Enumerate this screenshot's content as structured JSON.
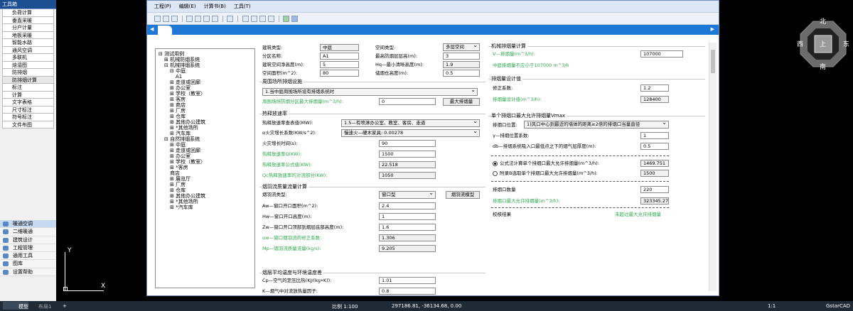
{
  "toolbox": {
    "title": "工具箱",
    "commands": [
      "负荷计算",
      "垂直采暖",
      "分户计量",
      "地板采暖",
      "智能水路",
      "通风空调",
      "多联机",
      "焓湿图",
      "防排烟",
      "防排烟计算",
      "标注",
      "计算",
      "文字表格",
      "尺寸标注",
      "符号标注",
      "文件布图"
    ],
    "active_index": 9,
    "categories": [
      "暖通空调",
      "二维暖通",
      "建筑设计",
      "工程管理",
      "通用工具",
      "图库",
      "设置帮助"
    ],
    "active_category": 0
  },
  "window": {
    "menus": [
      "工程(P)",
      "编辑(E)",
      "计算书(B)",
      "工具(T)"
    ]
  },
  "tree": {
    "root": "测试用例",
    "nodes": [
      {
        "t": "机械防烟系统",
        "lv": 1,
        "e": "+"
      },
      {
        "t": "机械排烟系统",
        "lv": 1,
        "e": "-"
      },
      {
        "t": "中庭",
        "lv": 2,
        "e": "-"
      },
      {
        "t": "A1",
        "lv": 3,
        "e": ""
      },
      {
        "t": "走道或回廊",
        "lv": 2,
        "e": "+"
      },
      {
        "t": "办公室",
        "lv": 2,
        "e": "+"
      },
      {
        "t": "学校（教室）",
        "lv": 2,
        "e": "+"
      },
      {
        "t": "客房",
        "lv": 2,
        "e": "+"
      },
      {
        "t": "商店",
        "lv": 2,
        "e": "+"
      },
      {
        "t": "厂房",
        "lv": 2,
        "e": "+"
      },
      {
        "t": "仓库",
        "lv": 2,
        "e": "+"
      },
      {
        "t": "其他办公建筑",
        "lv": 2,
        "e": "+"
      },
      {
        "t": "*其他场所",
        "lv": 2,
        "e": "+"
      },
      {
        "t": "汽车库",
        "lv": 2,
        "e": "+"
      },
      {
        "t": "自然排烟系统",
        "lv": 1,
        "e": "-"
      },
      {
        "t": "中庭",
        "lv": 2,
        "e": "+"
      },
      {
        "t": "走道或回廊",
        "lv": 2,
        "e": "+"
      },
      {
        "t": "办公室",
        "lv": 2,
        "e": "+"
      },
      {
        "t": "学校（教室）",
        "lv": 2,
        "e": "+"
      },
      {
        "t": "*客房",
        "lv": 2,
        "e": "+"
      },
      {
        "t": "商店",
        "lv": 2,
        "e": ""
      },
      {
        "t": "展览厅",
        "lv": 2,
        "e": "+"
      },
      {
        "t": "厂房",
        "lv": 2,
        "e": "+"
      },
      {
        "t": "仓库",
        "lv": 2,
        "e": "+"
      },
      {
        "t": "其他办公建筑",
        "lv": 2,
        "e": "+"
      },
      {
        "t": "*其他场所",
        "lv": 2,
        "e": "+"
      },
      {
        "t": "*汽车库",
        "lv": 2,
        "e": "+"
      }
    ]
  },
  "form": {
    "building_type_label": "建筑类型:",
    "building_type": "中庭",
    "space_type_label": "空间类型:",
    "space_type": "多层空间",
    "zone_name_label": "分区名称:",
    "zone_name": "A1",
    "max_floor_h_label": "最高防烟层层高(m):",
    "max_floor_h": "3",
    "net_h_label": "建筑空间净高度(m):",
    "net_h": "5",
    "hq_label": "Hq—最小清晰高度(m):",
    "hq": "1.9",
    "area_label": "空间面积(m^2):",
    "area": "80",
    "storage_h_label": "储烟仓高度(m):",
    "storage_h": "0.5",
    "surround_header": "周围场所排烟设施",
    "surround_select": "1.当中庭周围场所设有排烟系统时",
    "surround_flow_label": "周围场所防烟分区最大排烟量(m^3/h):",
    "surround_flow": "0",
    "max_exhaust_btn": "最大排烟量",
    "heat_header": "热释放速率",
    "heat_table_label": "热释放速率查表值(MW):",
    "heat_table_value": "1.5—有喷淋办公室、教室、客房、走道",
    "alpha_label": "α火灾增长系数(KW/s^2):",
    "alpha_value": "慢速火—硬木家具: 0.00278",
    "fire_time_label": "火灾增长时间(s):",
    "fire_time": "90",
    "heat_rate_label": "热释放速率Q(KW):",
    "heat_rate": "1500",
    "heat_formula_label": "热释放速率公式值(KW):",
    "heat_formula": "22.518",
    "qc_label": "Qc热释放速率的对流部分(KW):",
    "qc": "1050",
    "plume_header": "烟羽流质量流量计算",
    "plume_type_label": "烟羽流类型:",
    "plume_type": "窗口型",
    "plume_model_btn": "烟羽流模型",
    "aw_label": "Aw—窗口开口面积(m^2):",
    "aw": "2.4",
    "hw_label": "Hw—窗口开口高度(m):",
    "hw": "1",
    "zw_label": "Zw—窗口开口顶部到烟层底部高度(m):",
    "zw": "1.6",
    "aw_corr_label": "αw—窗口烟羽流的修正系数:",
    "aw_corr": "1.306",
    "mp_label": "Mp—烟羽流质量流量(kg/s):",
    "mp": "9.205",
    "temp_header": "烟层平均温度与环境温度差",
    "cp_label": "Cp—空气的定压比热(KJ/(kg•K)):",
    "cp": "1.01",
    "k_label": "K—烟气中对流放热量因子:",
    "k": "0.8"
  },
  "right": {
    "mech_header": "机械排烟量计算",
    "v_label": "V—排烟量(m^3/h):",
    "v": "107000",
    "v_note": "中庭排烟量不应小于107000 m^3/h",
    "design_header": "排烟量设计值",
    "corr_label": "修正系数:",
    "corr": "1.2",
    "design_label": "排烟量设计值(m^3/h):",
    "design": "128400",
    "vmax_header": "单个排烟口最大允许排烟量Vmax",
    "pos_label": "排烟口位置:",
    "pos_value": "1)风口中心到最近的墙体的距离≥2倍的排烟口当量直径",
    "gamma_label": "γ—排烟位置系数:",
    "gamma": "1",
    "db_label": "db—排烟系统吸入口最低点之下的烟气层厚度(m):",
    "db": "0.5",
    "formula_radio": "公式法计算单个排烟口最大允许排烟量(m^3/h):",
    "formula_value": "1469.751",
    "appendix_radio": "附录B选取单个排烟口最大允许排烟量(m^3/h):",
    "appendix_value": "1500",
    "count_label": "排烟口数量",
    "count": "220",
    "max_flow_label": "排烟口最大允许排烟量(m^3/h):",
    "max_flow": "323345.276",
    "check_label": "校核结果",
    "check_value": "未超过最大允许排烟量"
  },
  "compass": {
    "north": "北",
    "south": "南",
    "east": "东",
    "west": "西",
    "center": "上"
  },
  "cad": {
    "y_label": "Y",
    "x_label": "X"
  },
  "status": {
    "tab_model": "模型",
    "tab_layout": "布局1",
    "scale": "比例 1:100",
    "coords": "297186.81, -36134.68, 0.00",
    "zoom": "1:1",
    "app": "GstarCAD"
  }
}
